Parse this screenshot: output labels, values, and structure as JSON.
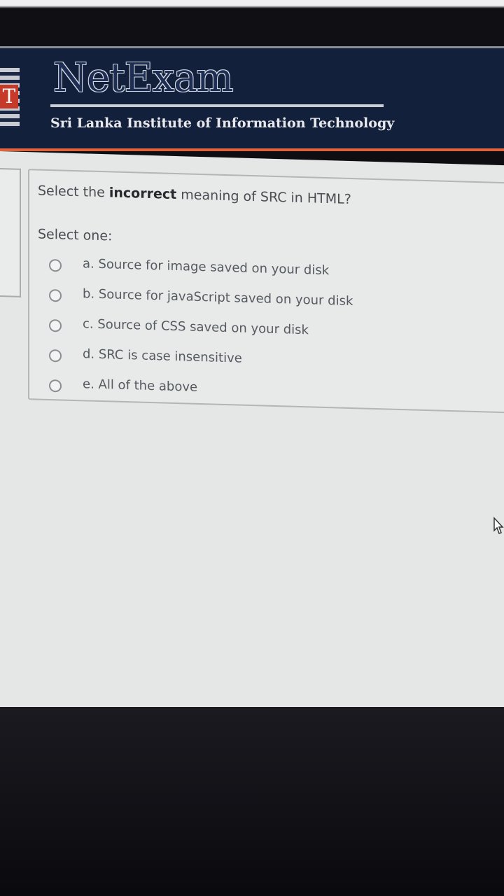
{
  "header": {
    "logo_letter": "T",
    "brand_title": "NetExam",
    "subtitle": "Sri Lanka Institute of Information Technology"
  },
  "question": {
    "prefix": "Select the ",
    "emphasis": "incorrect",
    "suffix": " meaning of SRC in HTML?",
    "select_label": "Select one:",
    "options": [
      {
        "label": "a. Source for image saved on your disk",
        "selected": false
      },
      {
        "label": "b. Source for javaScript saved on your disk",
        "selected": false
      },
      {
        "label": "c. Source of CSS saved on your disk",
        "selected": false
      },
      {
        "label": "d. SRC is case insensitive",
        "selected": false
      },
      {
        "label": "e. All of the above",
        "selected": false
      }
    ]
  },
  "colors": {
    "header_bg": "#13203c",
    "accent_rule": "#e0623a",
    "page_bg": "#e4e7e6"
  },
  "icons": [
    "mouse-pointer-icon",
    "radio-unchecked-icon"
  ]
}
